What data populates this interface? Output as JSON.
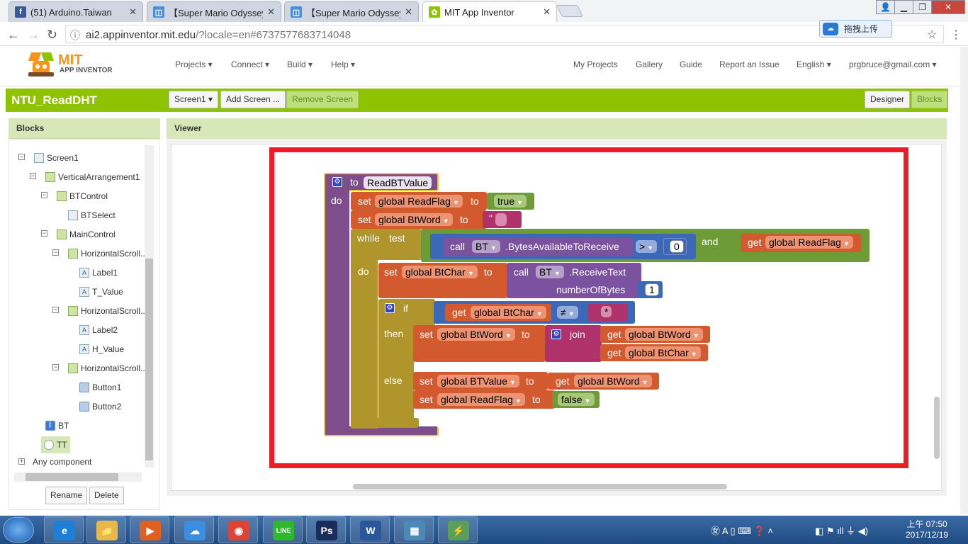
{
  "browser": {
    "tabs": [
      {
        "title": "(51) Arduino.Taiwan",
        "favicon": "facebook-icon",
        "color": "#3b5998"
      },
      {
        "title": "【Super Mario Odyssey",
        "favicon": "blog-icon",
        "color": "#4a90d9"
      },
      {
        "title": "【Super Mario Odyssey",
        "favicon": "blog-icon",
        "color": "#4a90d9"
      },
      {
        "title": "MIT App Inventor",
        "favicon": "appinventor-icon",
        "color": "#8fc202"
      }
    ],
    "url_host": "ai2.appinventor.mit.edu",
    "url_rest": "/?locale=en#6737577683714048",
    "upload_button": "拖拽上传"
  },
  "app": {
    "logo_mit": "MIT",
    "logo_sub": "APP INVENTOR",
    "menus": [
      "Projects ▾",
      "Connect ▾",
      "Build ▾",
      "Help ▾"
    ],
    "right_menus": [
      "My Projects",
      "Gallery",
      "Guide",
      "Report an Issue",
      "English ▾",
      "prgbruce@gmail.com ▾"
    ],
    "project_name": "NTU_ReadDHT",
    "screen_select": "Screen1 ▾",
    "add_screen": "Add Screen ...",
    "remove_screen": "Remove Screen",
    "designer": "Designer",
    "blocks_btn": "Blocks"
  },
  "blocks_panel": {
    "title": "Blocks",
    "tree": [
      {
        "label": "Screen1",
        "level": 0,
        "toggle": "⊟",
        "icon": "screen-icon"
      },
      {
        "label": "VerticalArrangement1",
        "level": 1,
        "toggle": "⊟",
        "icon": "arrangement-icon"
      },
      {
        "label": "BTControl",
        "level": 2,
        "toggle": "⊟",
        "icon": "arrangement-icon"
      },
      {
        "label": "BTSelect",
        "level": 3,
        "toggle": "",
        "icon": "listpicker-icon"
      },
      {
        "label": "MainControl",
        "level": 2,
        "toggle": "⊟",
        "icon": "arrangement-icon"
      },
      {
        "label": "HorizontalScroll...",
        "level": 3,
        "toggle": "⊟",
        "icon": "arrangement-icon"
      },
      {
        "label": "Label1",
        "level": 4,
        "toggle": "",
        "icon": "label-icon"
      },
      {
        "label": "T_Value",
        "level": 4,
        "toggle": "",
        "icon": "label-icon"
      },
      {
        "label": "HorizontalScroll...",
        "level": 3,
        "toggle": "⊟",
        "icon": "arrangement-icon"
      },
      {
        "label": "Label2",
        "level": 4,
        "toggle": "",
        "icon": "label-icon"
      },
      {
        "label": "H_Value",
        "level": 4,
        "toggle": "",
        "icon": "label-icon"
      },
      {
        "label": "HorizontalScroll...",
        "level": 3,
        "toggle": "⊟",
        "icon": "arrangement-icon"
      },
      {
        "label": "Button1",
        "level": 4,
        "toggle": "",
        "icon": "button-icon"
      },
      {
        "label": "Button2",
        "level": 4,
        "toggle": "",
        "icon": "button-icon"
      },
      {
        "label": "BT",
        "level": 1,
        "toggle": "",
        "icon": "bluetooth-icon"
      },
      {
        "label": "TT",
        "level": 1,
        "toggle": "",
        "icon": "clock-icon"
      }
    ],
    "any_component": "Any component",
    "rename": "Rename",
    "delete": "Delete"
  },
  "viewer": {
    "title": "Viewer",
    "blocks": {
      "proc_to": "to",
      "proc_name": "ReadBTValue",
      "do": "do",
      "set": "set",
      "to": "to",
      "global_readflag": "global ReadFlag",
      "true": "true",
      "global_btword": "global BtWord",
      "empty_text": "\" \"",
      "while": "while",
      "test": "test",
      "call": "call",
      "bt": "BT",
      "bytes_available": ".BytesAvailableToReceive",
      "gt": ">",
      "zero": "0",
      "and": "and",
      "get": "get",
      "global_btchar": "global BtChar",
      "receive_text": ".ReceiveText",
      "number_of_bytes": "numberOfBytes",
      "one": "1",
      "if": "if",
      "neq": "≠",
      "star_text": "*",
      "then": "then",
      "join": "join",
      "else": "else",
      "global_btvalue": "global BTValue",
      "false": "false"
    }
  },
  "taskbar": {
    "apps": [
      {
        "name": "ie-icon",
        "label": "e",
        "color": "#1e7fd9"
      },
      {
        "name": "explorer-icon",
        "label": "📁",
        "color": "#e8b84a"
      },
      {
        "name": "media-icon",
        "label": "▶",
        "color": "#e06020"
      },
      {
        "name": "baidu-cloud-icon",
        "label": "☁",
        "color": "#3b8ee0"
      },
      {
        "name": "chrome-icon",
        "label": "◉",
        "color": "#dd4433"
      },
      {
        "name": "line-icon",
        "label": "LINE",
        "color": "#2eb82e"
      },
      {
        "name": "photoshop-icon",
        "label": "Ps",
        "color": "#1a2c5a"
      },
      {
        "name": "word-icon",
        "label": "W",
        "color": "#2b579a"
      },
      {
        "name": "photos-icon",
        "label": "▦",
        "color": "#4c88b8"
      },
      {
        "name": "arduino-icon",
        "label": "⚡",
        "color": "#5aa05a"
      }
    ],
    "time": "上午 07:50",
    "date": "2017/12/19"
  }
}
